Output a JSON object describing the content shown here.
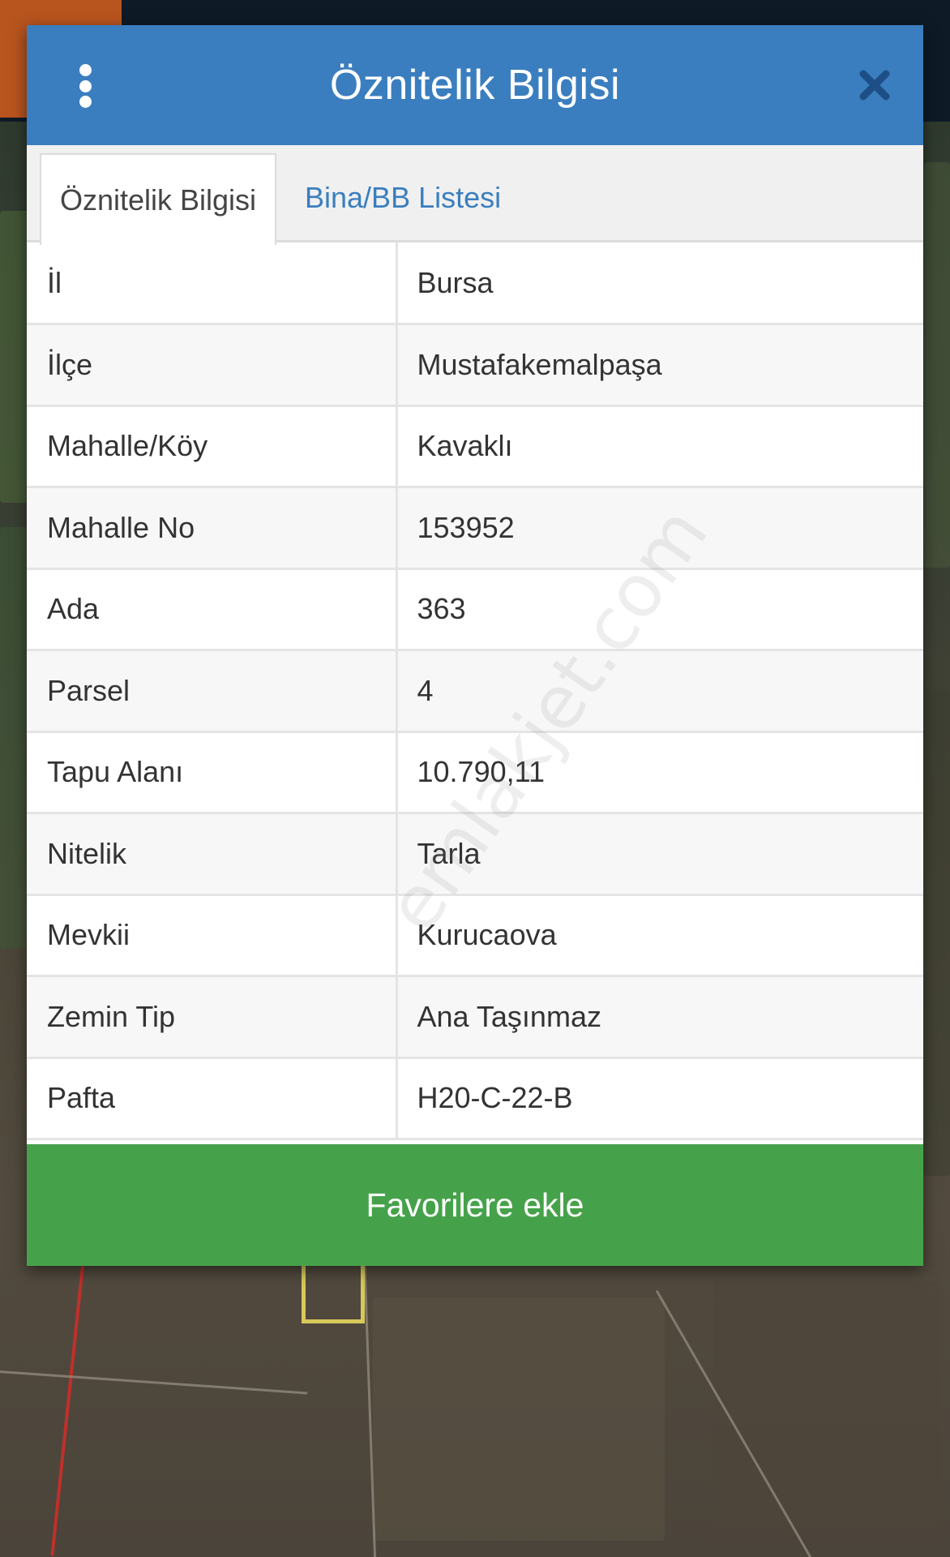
{
  "dialog": {
    "title": "Öznitelik Bilgisi",
    "menu_icon": "more-vertical-icon",
    "close_icon": "close-icon"
  },
  "tabs": [
    {
      "label": "Öznitelik Bilgisi",
      "active": true
    },
    {
      "label": "Bina/BB Listesi",
      "active": false
    }
  ],
  "attributes": [
    {
      "key": "İl",
      "value": "Bursa"
    },
    {
      "key": "İlçe",
      "value": "Mustafakemalpaşa"
    },
    {
      "key": "Mahalle/Köy",
      "value": "Kavaklı"
    },
    {
      "key": "Mahalle No",
      "value": "153952"
    },
    {
      "key": "Ada",
      "value": "363"
    },
    {
      "key": "Parsel",
      "value": "4"
    },
    {
      "key": "Tapu Alanı",
      "value": "10.790,11"
    },
    {
      "key": "Nitelik",
      "value": "Tarla"
    },
    {
      "key": "Mevkii",
      "value": "Kurucaova"
    },
    {
      "key": "Zemin Tip",
      "value": "Ana Taşınmaz"
    },
    {
      "key": "Pafta",
      "value": "H20-C-22-B"
    }
  ],
  "favorite_button": {
    "label": "Favorilere ekle"
  },
  "watermark": "emlakjet.com",
  "colors": {
    "header": "#3a7ebf",
    "tab_link": "#3a7ebf",
    "button": "#46a24a"
  }
}
